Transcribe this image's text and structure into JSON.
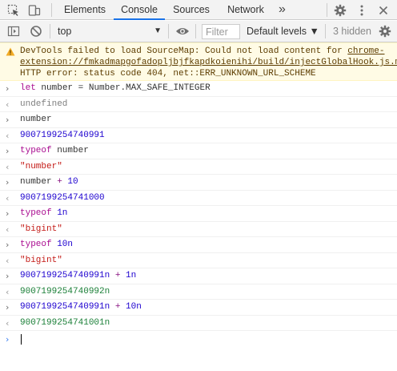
{
  "tabs": {
    "items": [
      {
        "label": "Elements"
      },
      {
        "label": "Console"
      },
      {
        "label": "Sources"
      },
      {
        "label": "Network"
      }
    ],
    "active": "Console",
    "more": "»"
  },
  "toolbar": {
    "context": "top",
    "filter_placeholder": "Filter",
    "levels_label": "Default levels ▼",
    "hidden_label": "3 hidden"
  },
  "warning": {
    "prefix": "DevTools failed to load SourceMap: Could not load content for ",
    "url": "chrome-extension://fmkadmapgofadopljbjfkapdkoienihi/build/injectGlobalHook.js.map",
    "suffix": ": HTTP error: status code 404, net::ERR_UNKNOWN_URL_SCHEME"
  },
  "entries": {
    "in1": {
      "let": "let",
      "name": "number",
      "eq": " = ",
      "rhs": "Number.MAX_SAFE_INTEGER"
    },
    "out1": "undefined",
    "in2": "number",
    "out2": "9007199254740991",
    "in3": {
      "kw": "typeof",
      "arg": " number"
    },
    "out3": "\"number\"",
    "in4": {
      "lhs": "number",
      "op": " + ",
      "rhs": "10"
    },
    "out4": "9007199254741000",
    "in5": {
      "kw": "typeof",
      "arg": " 1n"
    },
    "out5": "\"bigint\"",
    "in6": {
      "kw": "typeof",
      "arg": " 10n"
    },
    "out6": "\"bigint\"",
    "in7": {
      "lhs": "9007199254740991n",
      "op": " + ",
      "rhs": "1n"
    },
    "out7": "9007199254740992n",
    "in8": {
      "lhs": "9007199254740991n",
      "op": " + ",
      "rhs": "10n"
    },
    "out8": "9007199254741001n"
  },
  "icons": {
    "inspect": "inspect-element-icon",
    "device": "device-toolbar-icon",
    "settings": "gear-icon",
    "menu": "kebab-menu-icon",
    "sidebar": "sidebar-toggle-icon",
    "clear": "clear-console-icon",
    "eye": "live-expression-icon",
    "console_settings": "console-settings-icon"
  },
  "colors": {
    "accent": "#1a73e8",
    "warning_bg": "#fffbe5",
    "warning_text": "#5c3c00",
    "keyword": "#aa0d91",
    "number": "#1c00cf",
    "string": "#c41a16",
    "bigint": "#1a7f37"
  }
}
